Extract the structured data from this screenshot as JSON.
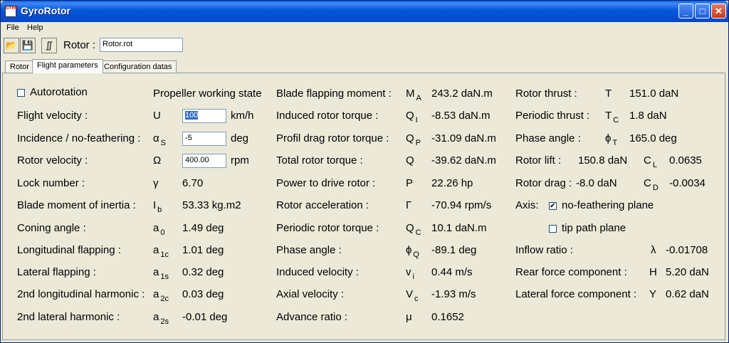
{
  "window": {
    "title": "GyroRotor",
    "icon_text": "GYRO",
    "minimize": "_",
    "maximize": "□",
    "close": "✕"
  },
  "menu": [
    {
      "label": "File"
    },
    {
      "label": "Help"
    }
  ],
  "toolbar": {
    "open_icon": "📂",
    "save_icon": "💾",
    "calc_icon": "∬",
    "rotor_label": "Rotor :",
    "rotor_file": "Rotor.rot"
  },
  "tabs": [
    {
      "label": "Rotor"
    },
    {
      "label": "Flight parameters"
    },
    {
      "label": "Configuration datas"
    }
  ],
  "col1": {
    "autorotation": {
      "label": "Autorotation",
      "checked": false
    },
    "flight_velocity": {
      "label": "Flight velocity :",
      "sym": "U",
      "value": "100",
      "unit": "km/h"
    },
    "incidence": {
      "label": "Incidence / no-feathering :",
      "sym": "α",
      "sub": "S",
      "value": "-5",
      "unit": "deg"
    },
    "rotor_velocity": {
      "label": "Rotor velocity :",
      "sym": "Ω",
      "value": "400.00",
      "unit": "rpm"
    },
    "lock": {
      "label": "Lock number :",
      "sym": "γ",
      "value": "6.70"
    },
    "inertia": {
      "label": "Blade moment of inertia :",
      "sym": "I",
      "sub": "b",
      "value": "53.33 kg.m2"
    },
    "coning": {
      "label": "Coning angle :",
      "sym": "a",
      "sub": "0",
      "value": "1.49 deg"
    },
    "long_flap": {
      "label": "Longitudinal flapping :",
      "sym": "a",
      "sub": "1c",
      "value": "1.01 deg"
    },
    "lat_flap": {
      "label": "Lateral flapping :",
      "sym": "a",
      "sub": "1s",
      "value": "0.32 deg"
    },
    "long_harm": {
      "label": "2nd longitudinal harmonic :",
      "sym": "a",
      "sub": "2c",
      "value": "0.03 deg"
    },
    "lat_harm": {
      "label": "2nd lateral harmonic :",
      "sym": "a",
      "sub": "2s",
      "value": "-0.01 deg"
    }
  },
  "propeller_state": "Propeller working state",
  "col2": [
    {
      "label": "Blade flapping  moment :",
      "sym": "M",
      "sub": "A",
      "value": "243.2 daN.m"
    },
    {
      "label": "Induced rotor torque :",
      "sym": "Q",
      "sub": "I",
      "value": "-8.53 daN.m"
    },
    {
      "label": "Profil drag rotor torque :",
      "sym": "Q",
      "sub": "P",
      "value": "-31.09 daN.m"
    },
    {
      "label": "Total rotor torque :",
      "sym": "Q",
      "sub": "",
      "value": "-39.62 daN.m"
    },
    {
      "label": "Power to drive rotor :",
      "sym": "P",
      "sub": "",
      "value": "22.26 hp"
    },
    {
      "label": "Rotor acceleration :",
      "sym": "Γ",
      "sub": "",
      "value": "-70.94 rpm/s"
    },
    {
      "label": "Periodic rotor torque :",
      "sym": "Q",
      "sub": "C",
      "value": "10.1 daN.m"
    },
    {
      "label": "Phase angle :",
      "sym": "ϕ",
      "sub": "Q",
      "value": "-89.1 deg"
    },
    {
      "label": "Induced velocity :",
      "sym": "v",
      "sub": "i",
      "value": "0.44 m/s"
    },
    {
      "label": "Axial velocity :",
      "sym": "V",
      "sub": "c",
      "value": "-1.93 m/s"
    },
    {
      "label": "Advance ratio :",
      "sym": "μ",
      "sub": "",
      "value": "0.1652"
    }
  ],
  "col3": {
    "thrust": {
      "label": "Rotor thrust :",
      "sym": "T",
      "value": "151.0 daN"
    },
    "periodic_thrust": {
      "label": "Periodic thrust :",
      "sym": "T",
      "sub": "C",
      "value": "1.8 daN"
    },
    "phase": {
      "label": "Phase angle :",
      "sym": "ϕ",
      "sub": "T",
      "value": "165.0 deg"
    },
    "lift": {
      "label": "Rotor lift :",
      "value": "150.8 daN",
      "coef_sym": "C",
      "coef_sub": "L",
      "coef_value": "0.0635"
    },
    "drag": {
      "label": "Rotor drag :",
      "value": "-8.0 daN",
      "coef_sym": "C",
      "coef_sub": "D",
      "coef_value": "-0.0034"
    },
    "axis": {
      "label": "Axis:",
      "opt1": "no-feathering plane",
      "opt1_checked": true,
      "opt2": "tip path plane",
      "opt2_checked": false
    },
    "inflow": {
      "label": "Inflow ratio :",
      "sym": "λ",
      "value": "-0.01708"
    },
    "rear": {
      "label": "Rear force component :",
      "sym": "H",
      "value": "5.20 daN"
    },
    "lateral": {
      "label": "Lateral force component :",
      "sym": "Y",
      "value": "0.62 daN"
    }
  },
  "check_mark": "✔"
}
